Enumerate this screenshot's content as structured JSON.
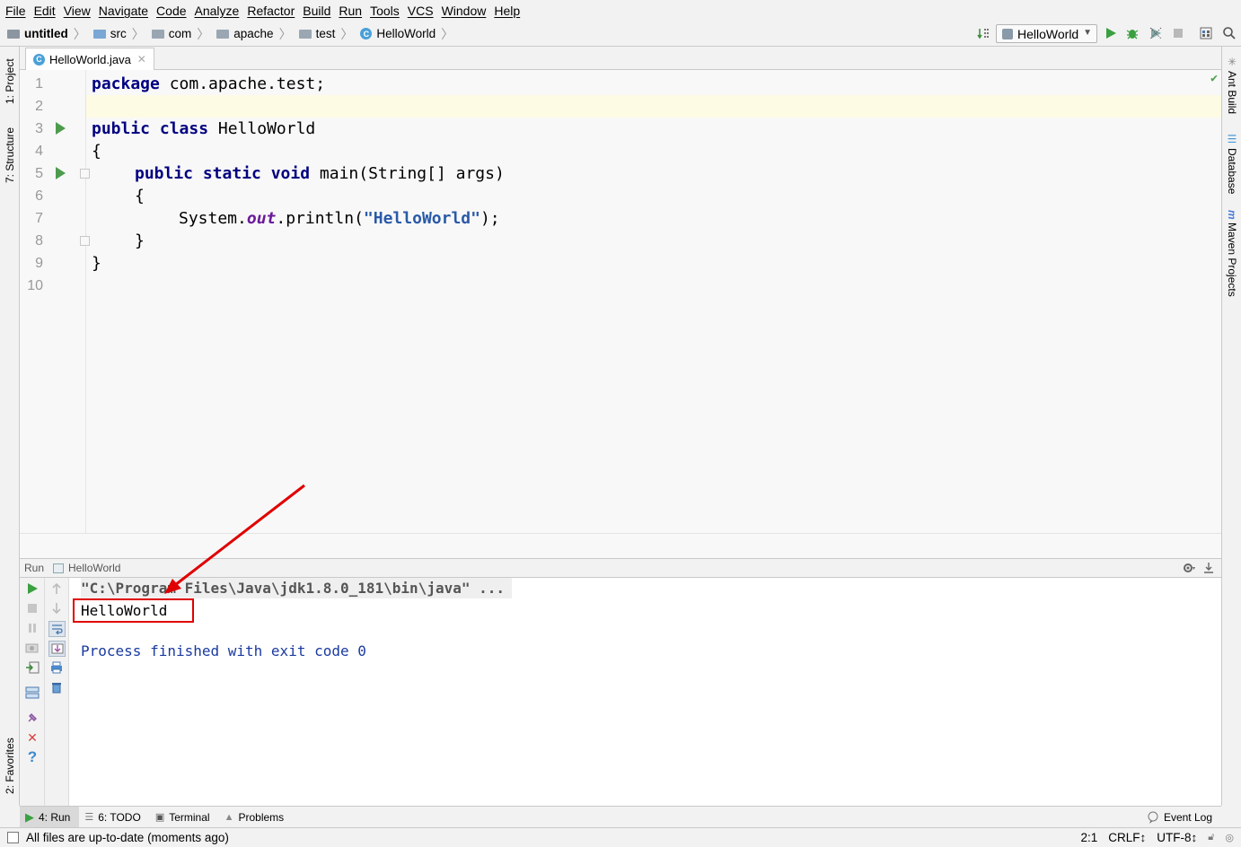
{
  "menu": [
    "File",
    "Edit",
    "View",
    "Navigate",
    "Code",
    "Analyze",
    "Refactor",
    "Build",
    "Run",
    "Tools",
    "VCS",
    "Window",
    "Help"
  ],
  "breadcrumbs": [
    "untitled",
    "src",
    "com",
    "apache",
    "test",
    "HelloWorld"
  ],
  "run_config": "HelloWorld",
  "left_tools": {
    "project": "1: Project",
    "structure": "7: Structure",
    "favorites": "2: Favorites"
  },
  "right_tools": {
    "ant": "Ant Build",
    "database": "Database",
    "maven": "Maven Projects"
  },
  "editor_tab": "HelloWorld.java",
  "line_numbers": [
    "1",
    "2",
    "3",
    "4",
    "5",
    "6",
    "7",
    "8",
    "9",
    "10"
  ],
  "code": {
    "l1_kw": "package",
    "l1_rest": " com.apache.test;",
    "l3_kw": "public class",
    "l3_rest": " HelloWorld",
    "l4": "{",
    "l5_kw": "public static void",
    "l5_rest": " main(String[] args)",
    "l6": "{",
    "l7_a": "System.",
    "l7_field": "out",
    "l7_b": ".println(",
    "l7_str": "\"HelloWorld\"",
    "l7_c": ");",
    "l8": "}",
    "l9": "}"
  },
  "run_panel": {
    "label": "Run",
    "config": "HelloWorld"
  },
  "console": {
    "command": "\"C:\\Program Files\\Java\\jdk1.8.0_181\\bin\\java\" ...",
    "output": "HelloWorld",
    "finished": "Process finished with exit code 0"
  },
  "bottom_tabs": [
    {
      "label": "4: Run",
      "icon": "run-icon"
    },
    {
      "label": "6: TODO",
      "icon": "todo-icon"
    },
    {
      "label": "Terminal",
      "icon": "terminal-icon"
    },
    {
      "label": "Problems",
      "icon": "problems-icon"
    }
  ],
  "event_log": "Event Log",
  "status": {
    "message": "All files are up-to-date (moments ago)",
    "position": "2:1",
    "line_sep": "CRLF↕",
    "encoding": "UTF-8↕"
  },
  "colors": {
    "keyword": "#000080",
    "string": "#2a5aa8",
    "annotation": "#e00000",
    "run_green": "#4d9c4d"
  }
}
